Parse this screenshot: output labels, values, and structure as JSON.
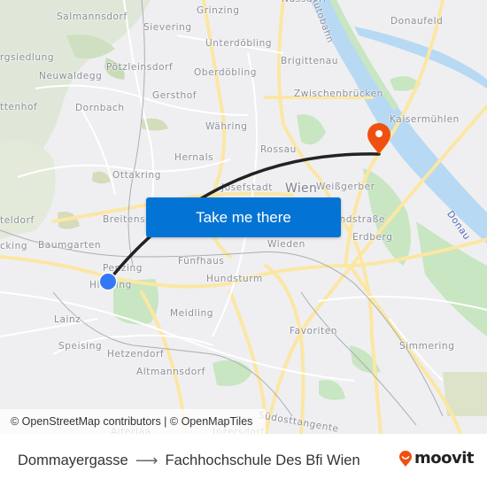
{
  "map": {
    "labels": [
      {
        "text": "Nussdorf",
        "kind": "district"
      },
      {
        "text": "Salmannsdorf",
        "kind": "district"
      },
      {
        "text": "Grinzing",
        "kind": "district"
      },
      {
        "text": "Sievering",
        "kind": "district"
      },
      {
        "text": "Donaufeld",
        "kind": "district"
      },
      {
        "text": "Unterdöbling",
        "kind": "district"
      },
      {
        "text": "rgsiedlung",
        "kind": "district"
      },
      {
        "text": "Pötzleinsdorf",
        "kind": "district"
      },
      {
        "text": "Oberdöbling",
        "kind": "district"
      },
      {
        "text": "Brigittenau",
        "kind": "district"
      },
      {
        "text": "Neuwaldegg",
        "kind": "district"
      },
      {
        "text": "Gersthof",
        "kind": "district"
      },
      {
        "text": "Zwischenbrücken",
        "kind": "district"
      },
      {
        "text": "ttenhof",
        "kind": "district"
      },
      {
        "text": "Dornbach",
        "kind": "district"
      },
      {
        "text": "Kaisermühlen",
        "kind": "district"
      },
      {
        "text": "Währing",
        "kind": "district"
      },
      {
        "text": "Rossau",
        "kind": "district"
      },
      {
        "text": "Hernals",
        "kind": "district"
      },
      {
        "text": "Ottakring",
        "kind": "district"
      },
      {
        "text": "Josefstadt",
        "kind": "district"
      },
      {
        "text": "Wien",
        "kind": "city"
      },
      {
        "text": "Weißgerber",
        "kind": "district"
      },
      {
        "text": "teldorf",
        "kind": "district"
      },
      {
        "text": "Breitensee",
        "kind": "district"
      },
      {
        "text": "Landstraße",
        "kind": "district"
      },
      {
        "text": "Wieden",
        "kind": "district"
      },
      {
        "text": "Erdberg",
        "kind": "district"
      },
      {
        "text": "Baumgarten",
        "kind": "district"
      },
      {
        "text": "cking",
        "kind": "district"
      },
      {
        "text": "Fünfhaus",
        "kind": "district"
      },
      {
        "text": "Penzing",
        "kind": "district"
      },
      {
        "text": "Hundsturm",
        "kind": "district"
      },
      {
        "text": "Hietzing",
        "kind": "district"
      },
      {
        "text": "Meidling",
        "kind": "district"
      },
      {
        "text": "Lainz",
        "kind": "district"
      },
      {
        "text": "Favoriten",
        "kind": "district"
      },
      {
        "text": "Speising",
        "kind": "district"
      },
      {
        "text": "Simmering",
        "kind": "district"
      },
      {
        "text": "Hetzendorf",
        "kind": "district"
      },
      {
        "text": "Altmannsdorf",
        "kind": "district"
      },
      {
        "text": "Donau",
        "kind": "water"
      },
      {
        "text": "Autobahn",
        "kind": "road"
      },
      {
        "text": "Südosttangente",
        "kind": "road"
      },
      {
        "text": "Alterlaa",
        "kind": "district"
      },
      {
        "text": "Inzersdorf",
        "kind": "district"
      }
    ],
    "origin_marker": {
      "name": "Dommayergasse",
      "color": "#3478f6"
    },
    "destination_marker": {
      "name": "Fachhochschule Des Bfi Wien",
      "color": "#f0500f"
    },
    "route_line_color": "#222222",
    "cta_button": {
      "label": "Take me there",
      "color": "#0474d4"
    },
    "attribution": "© OpenStreetMap contributors | © OpenMapTiles"
  },
  "footer": {
    "origin": "Dommayergasse",
    "arrow": "⟶",
    "destination": "Fachhochschule Des Bfi Wien",
    "logo_text": "moovit",
    "logo_color": "#f0500f"
  }
}
